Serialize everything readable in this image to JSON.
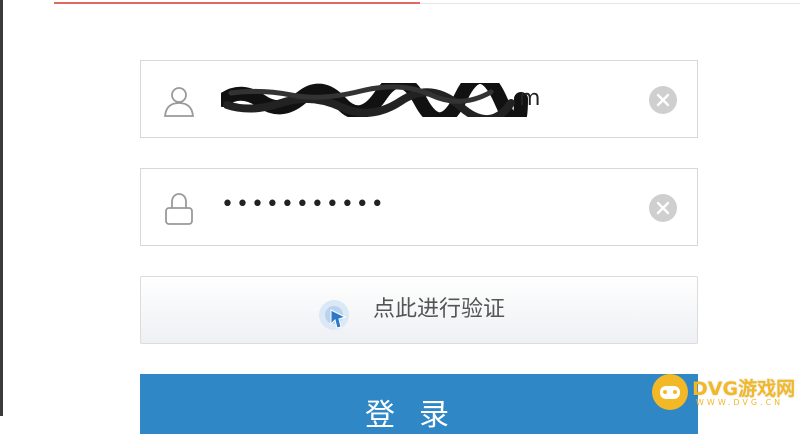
{
  "username_field": {
    "value_visible": "m",
    "clear_icon": "clear-circle-icon",
    "field_icon": "user-icon"
  },
  "password_field": {
    "value": "•••••••••••",
    "clear_icon": "clear-circle-icon",
    "field_icon": "lock-icon"
  },
  "verify_button": {
    "label": "点此进行验证",
    "icon": "cursor-pointer-icon"
  },
  "login_button": {
    "label": "登录"
  },
  "watermark": {
    "text": "DVG游戏网",
    "sub": "WWW.DVG.CN"
  },
  "colors": {
    "accent_tab": "#e06a62",
    "login_blue": "#2f87c6",
    "watermark_yellow": "#f2b826"
  }
}
